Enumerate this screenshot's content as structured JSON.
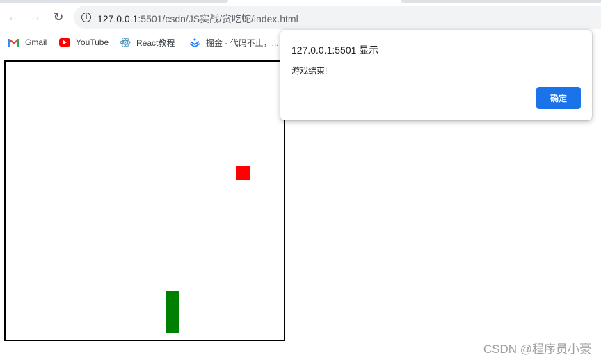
{
  "browser": {
    "url_host": "127.0.0.1",
    "url_rest": ":5501/csdn/JS实战/贪吃蛇/index.html",
    "nav": {
      "back_icon": "arrow-left-icon",
      "forward_icon": "arrow-right-icon",
      "reload_icon": "reload-icon"
    },
    "bookmarks": [
      {
        "label": "Gmail",
        "icon": "gmail-icon"
      },
      {
        "label": "YouTube",
        "icon": "youtube-icon"
      },
      {
        "label": "React教程",
        "icon": "react-icon"
      },
      {
        "label": "掘金 - 代码不止，...",
        "icon": "juejin-icon"
      }
    ]
  },
  "game": {
    "board_color": "#000000",
    "food": {
      "col": 17,
      "row": 7,
      "color": "#ff0000"
    },
    "snake": {
      "color": "#008000",
      "segments": [
        {
          "col": 11,
          "row": 17
        },
        {
          "col": 11,
          "row": 18
        },
        {
          "col": 11,
          "row": 19
        }
      ]
    }
  },
  "dialog": {
    "title": "127.0.0.1:5501 显示",
    "message": "游戏结束!",
    "ok_label": "确定"
  },
  "watermark": "CSDN @程序员小豪"
}
